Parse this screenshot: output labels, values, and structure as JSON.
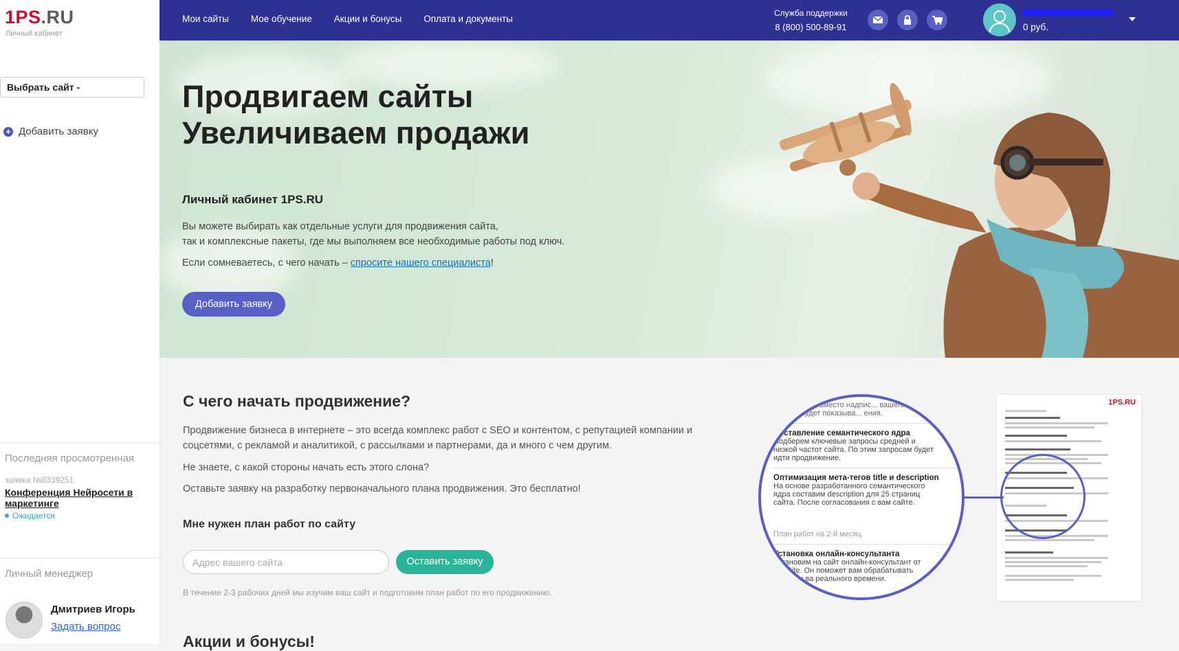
{
  "brand": {
    "logo_red": "1PS",
    "logo_gray": ".RU",
    "subtitle": "Личный кабинет"
  },
  "sidebar": {
    "site_select": "Выбрать сайт -",
    "add_request": "Добавить заявку",
    "last_viewed": {
      "heading": "Последняя просмотренная",
      "request_number": "заявка №8339251",
      "title": "Конференция Нейросети в маркетинге",
      "status": "Ожидается"
    },
    "manager": {
      "heading": "Личный менеджер",
      "name": "Дмитриев Игорь",
      "ask_link": "Задать вопрос"
    }
  },
  "header": {
    "nav": [
      "Мои сайты",
      "Мое обучение",
      "Акции и бонусы",
      "Оплата и документы"
    ],
    "support_label": "Служба поддержки",
    "support_phone": "8 (800) 500-89-91",
    "icons": [
      "envelope-icon",
      "lock-icon",
      "cart-icon"
    ],
    "balance": "0 руб."
  },
  "hero": {
    "title_line1": "Продвигаем сайты",
    "title_line2": "Увеличиваем продажи",
    "subtitle": "Личный кабинет 1PS.RU",
    "para1_line1": "Вы можете выбирать как отдельные услуги для продвижения сайта,",
    "para1_line2": "так и комплексные пакеты, где мы выполняем все необходимые работы под ключ.",
    "para2_prefix": "Если сомневаетесь, с чего начать – ",
    "para2_link": "спросите нашего специалиста",
    "para2_suffix": "!",
    "button": "Добавить заявку"
  },
  "start": {
    "heading": "С чего начать продвижение?",
    "para1": "Продвижение бизнеса в интернете – это всегда комплекс работ с SEO и контентом, с репутацией компании и соцсетями, с рекламой и аналитикой, с рассылками и партнерами, да и много с чем другим.",
    "question": "Не знаете, с какой стороны начать есть этого слона?",
    "offer": "Оставьте заявку на разработку первоначального плана продвижения. Это бесплатно!",
    "form_heading": "Мне нужен план работ по сайту",
    "input_placeholder": "Адрес вашего сайта",
    "button": "Оставить заявку",
    "note": "В течение 2-3 рабочих дней мы изучим ваш сайт и подготовим план работ по его продвижению.",
    "next_heading": "Акции и бонусы!"
  },
  "magnifier": {
    "top_text": "https вместо надпис... вашего сайта будет показыва... ения.",
    "item1_title": "Составление семантического ядра",
    "item1_text": "Подберем ключевые запросы средней и низкой частот сайта. По этим запросам будет идти продвижение.",
    "item2_title": "Оптимизация мета-тегов title и description",
    "item2_text": "На основе разработанного семантического ядра составим description для 25 страниц сайта. После согласования с вам сайте.",
    "month_label": "План работ на 2-й месяц",
    "item3_title": "Установка онлайн-консультанта",
    "item3_text": "Установим на сайт онлайн-консультант от JivoSite. Он поможет вам обрабатывать вопросы ва реального времени.",
    "doc_logo": "1PS.RU"
  },
  "colors": {
    "header": "#2e3192",
    "accent": "#5760c4",
    "green": "#2bb39a",
    "brand_red": "#c8102e"
  }
}
